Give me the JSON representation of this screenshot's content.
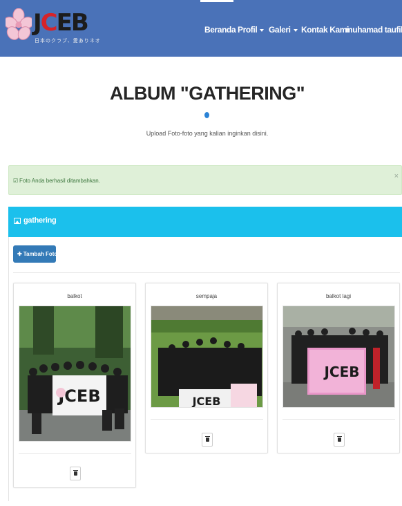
{
  "navbar": {
    "logo_text": "JCEB",
    "logo_tagline": "日本のクラブ、愛ありネオ",
    "items": [
      {
        "label": "Beranda",
        "caret": false
      },
      {
        "label": "Profil",
        "caret": true
      },
      {
        "label": "Galeri",
        "caret": true
      },
      {
        "label": "Kontak Kami",
        "caret": false
      },
      {
        "label": "muhamad taufik",
        "caret": true
      }
    ]
  },
  "page": {
    "title": "ALBUM \"GATHERING\"",
    "subtitle": "Upload Foto-foto yang kalian inginkan disini."
  },
  "alert": {
    "text": "Foto Anda berhasil ditambahkan.",
    "close_symbol": "×"
  },
  "panel": {
    "title": "gathering",
    "add_button_label": "Tambah Foto"
  },
  "photos": [
    {
      "title": "balkot",
      "banner_text": "JCEB"
    },
    {
      "title": "sempaja",
      "banner_text": "JCEB"
    },
    {
      "title": "balkot lagi",
      "banner_text": "JCEB"
    }
  ],
  "colors": {
    "navbar": "#4a72b8",
    "panel_heading": "#1bc0ec",
    "alert_bg": "#dff0d8",
    "button_primary": "#337ab7",
    "logo_red": "#d6232a"
  },
  "icons": [
    "sakura-flower-icon",
    "caret-down-icon",
    "check-icon",
    "close-icon",
    "image-icon",
    "plus-icon",
    "trash-icon"
  ]
}
